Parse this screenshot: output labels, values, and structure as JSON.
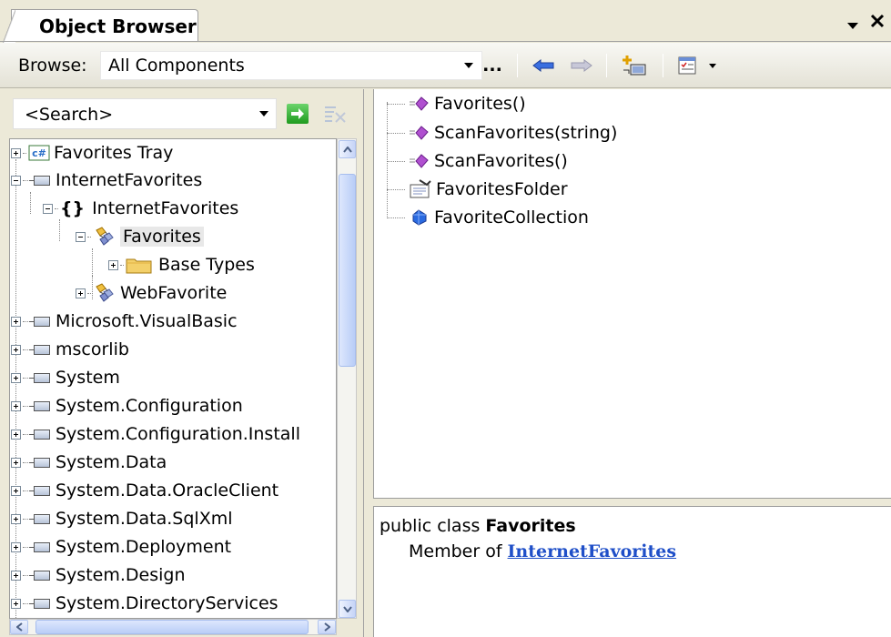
{
  "window": {
    "tab_title": "Object Browser",
    "pin_icon": "dropdown-arrow-icon",
    "close_icon": "close-icon"
  },
  "toolbar": {
    "browse_label": "Browse:",
    "browse_value": "All Components",
    "ellipsis": "...",
    "icons": [
      "back-arrow-icon",
      "forward-arrow-icon",
      "add-reference-icon",
      "settings-icon"
    ]
  },
  "search": {
    "placeholder": "<Search>"
  },
  "tree": {
    "items": [
      {
        "label": "Favorites Tray",
        "icon": "csharp-project-icon",
        "expanded": false
      },
      {
        "label": "InternetFavorites",
        "icon": "assembly-icon",
        "expanded": true
      },
      {
        "label": "InternetFavorites",
        "icon": "namespace-icon",
        "expanded": true
      },
      {
        "label": "Favorites",
        "icon": "class-icon",
        "expanded": true,
        "selected": true
      },
      {
        "label": "Base Types",
        "icon": "folder-icon",
        "expanded": false
      },
      {
        "label": "WebFavorite",
        "icon": "class-icon",
        "expanded": false
      },
      {
        "label": "Microsoft.VisualBasic",
        "icon": "assembly-icon",
        "expanded": false
      },
      {
        "label": "mscorlib",
        "icon": "assembly-icon",
        "expanded": false
      },
      {
        "label": "System",
        "icon": "assembly-icon",
        "expanded": false
      },
      {
        "label": "System.Configuration",
        "icon": "assembly-icon",
        "expanded": false
      },
      {
        "label": "System.Configuration.Install",
        "icon": "assembly-icon",
        "expanded": false
      },
      {
        "label": "System.Data",
        "icon": "assembly-icon",
        "expanded": false
      },
      {
        "label": "System.Data.OracleClient",
        "icon": "assembly-icon",
        "expanded": false
      },
      {
        "label": "System.Data.SqlXml",
        "icon": "assembly-icon",
        "expanded": false
      },
      {
        "label": "System.Deployment",
        "icon": "assembly-icon",
        "expanded": false
      },
      {
        "label": "System.Design",
        "icon": "assembly-icon",
        "expanded": false
      },
      {
        "label": "System.DirectoryServices",
        "icon": "assembly-icon",
        "expanded": false
      }
    ]
  },
  "members": {
    "items": [
      {
        "label": "Favorites()",
        "icon": "method-icon"
      },
      {
        "label": "ScanFavorites(string)",
        "icon": "method-icon"
      },
      {
        "label": "ScanFavorites()",
        "icon": "method-icon"
      },
      {
        "label": "FavoritesFolder",
        "icon": "property-icon"
      },
      {
        "label": "FavoriteCollection",
        "icon": "field-icon"
      }
    ]
  },
  "description": {
    "prefix": "public class ",
    "class_name": "Favorites",
    "member_of": "Member of ",
    "namespace_link": "InternetFavorites"
  },
  "colors": {
    "link": "#1f4fc8",
    "method": "#a040c0",
    "background": "#ece9d8"
  }
}
